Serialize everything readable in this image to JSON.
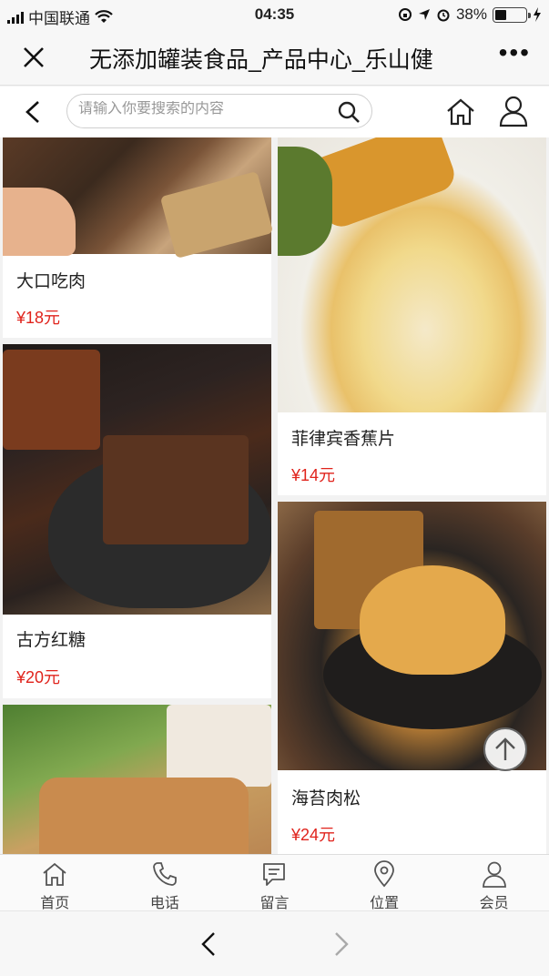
{
  "status": {
    "carrier": "中国联通",
    "time": "04:35",
    "battery": "38%",
    "battery_level": 0.38
  },
  "titlebar": {
    "title": "无添加罐装食品_产品中心_乐山健",
    "more_label": "•••"
  },
  "search": {
    "placeholder": "请输入你要搜索的内容"
  },
  "products": [
    {
      "name": "大口吃肉",
      "price": "¥18元"
    },
    {
      "name": "菲律宾香蕉片",
      "price": "¥14元"
    },
    {
      "name": "古方红糖",
      "price": "¥20元"
    },
    {
      "name": "海苔肉松",
      "price": "¥24元"
    }
  ],
  "tabs": [
    {
      "label": "首页",
      "icon": "home-icon"
    },
    {
      "label": "电话",
      "icon": "phone-icon"
    },
    {
      "label": "留言",
      "icon": "message-icon"
    },
    {
      "label": "位置",
      "icon": "location-icon"
    },
    {
      "label": "会员",
      "icon": "member-icon"
    }
  ],
  "colors": {
    "price": "#e0231c",
    "background": "#f2f2f2"
  }
}
